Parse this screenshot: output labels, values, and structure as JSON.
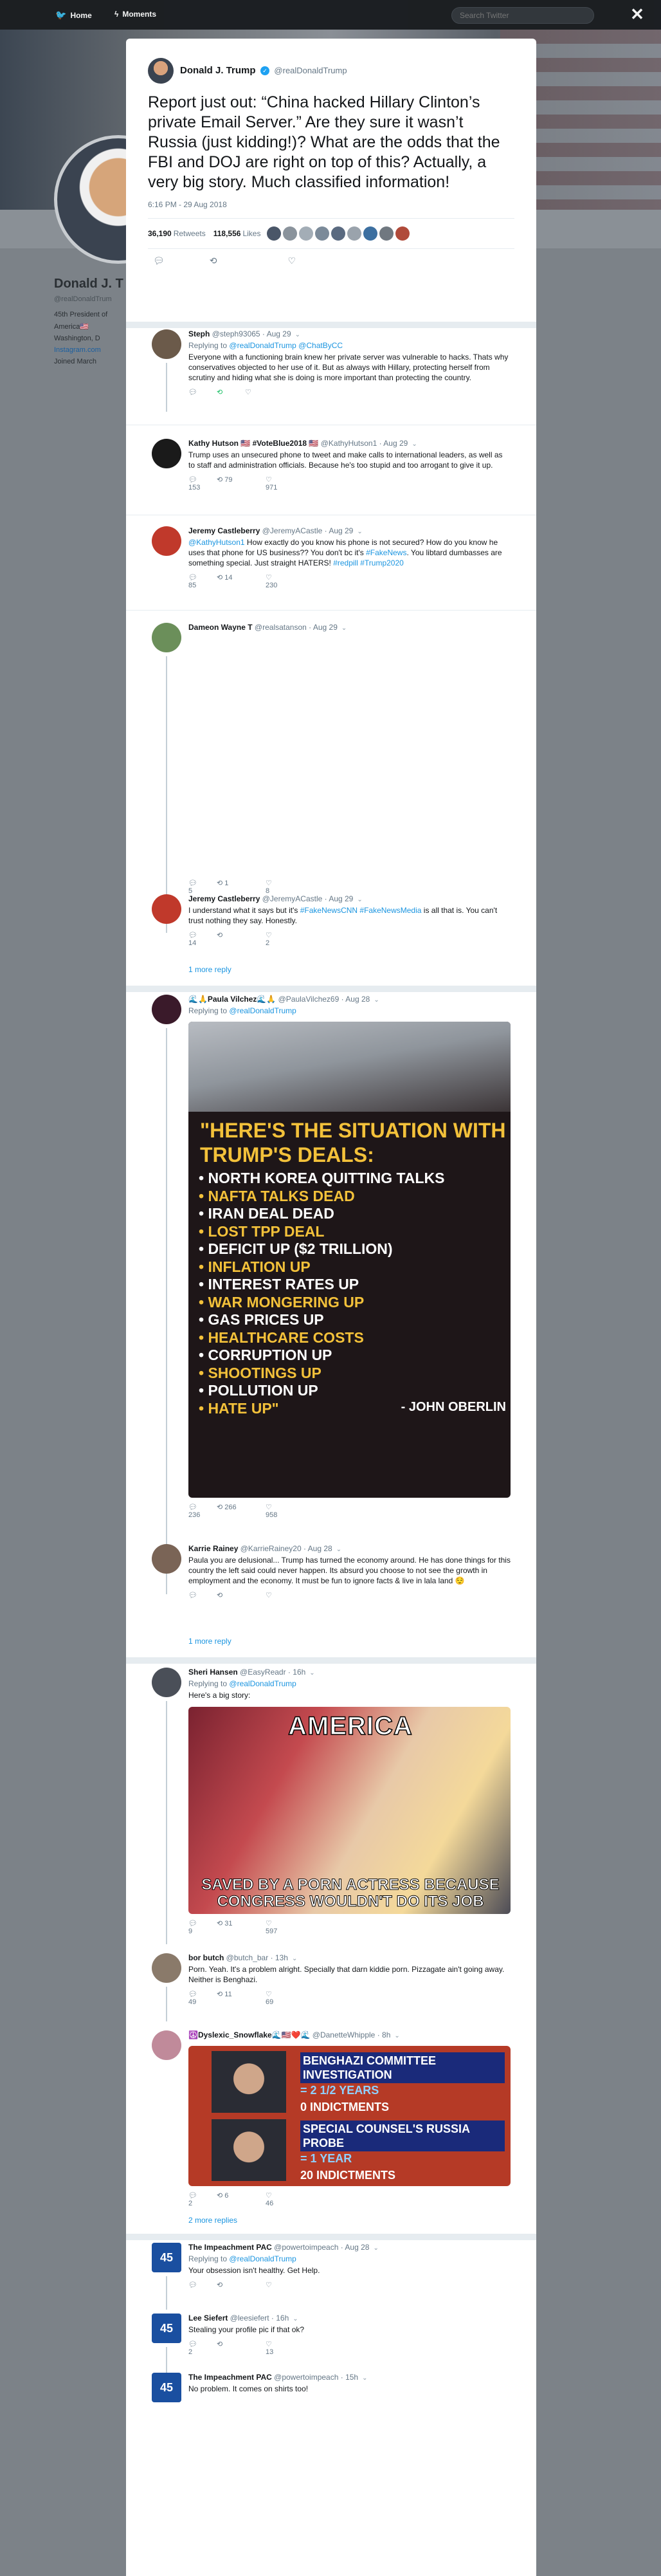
{
  "nav": {
    "home": "Home",
    "moments": "Moments",
    "search_placeholder": "Search Twitter",
    "close": "✕"
  },
  "background_profile": {
    "name": "Donald J. T",
    "handle": "@realDonaldTrum",
    "bio": "45th President of",
    "bio2": "America🇺🇸",
    "location": "Washington, D",
    "link": "Instagram.com",
    "joined": "Joined March"
  },
  "tweet": {
    "name": "Donald J. Trump",
    "handle": "@realDonaldTrump",
    "text": "Report just out: “China hacked Hillary Clinton’s private Email Server.” Are they sure it wasn’t Russia (just kidding!)? What are the odds that the FBI and DOJ are right on top of this? Actually, a very big story. Much classified information!",
    "time": "6:16 PM - 29 Aug 2018",
    "retweets": "36,190",
    "retweets_label": "Retweets",
    "likes": "118,556",
    "likes_label": "Likes"
  },
  "replies": [
    {
      "name": "Steph",
      "handle": "@steph93065",
      "date": "Aug 29",
      "replying": "Replying to",
      "replying_to": "@realDonaldTrump @ChatByCC",
      "text": "Everyone with a functioning brain knew her private server was vulnerable to hacks. Thats why conservatives objected to her use of it. But as always with Hillary, protecting herself from scrutiny and hiding what she is doing is more important than protecting the country.",
      "replies_count": "",
      "retweets_count": "",
      "likes_count": ""
    },
    {
      "name": "Kathy Hutson 🇺🇸 #VoteBlue2018 🇺🇸",
      "handle": "@KathyHutson1",
      "date": "Aug 29",
      "text": "Trump uses an unsecured phone to tweet and make calls to international leaders, as well as to staff and administration officials.  Because he's too stupid and too arrogant to give it up.",
      "replies_count": "153",
      "retweets_count": "79",
      "likes_count": "971"
    },
    {
      "name": "Jeremy Castleberry",
      "handle": "@JeremyACastle",
      "date": "Aug 29",
      "text_link": "@KathyHutson1",
      "text": " How exactly do you know his phone is not secured? How do you know he uses that phone for US business?? You don't bc it's ",
      "text_link2": "#FakeNews",
      "text2": ". You libtard dumbasses are something special. Just straight HATERS! ",
      "text_link3": "#redpill #Trump2020",
      "replies_count": "85",
      "retweets_count": "14",
      "likes_count": "230"
    },
    {
      "name": "Dameon Wayne T",
      "handle": "@realsatanson",
      "date": "Aug 29",
      "replies_count": "5",
      "retweets_count": "1",
      "likes_count": "8"
    },
    {
      "name": "Jeremy Castleberry",
      "handle": "@JeremyACastle",
      "date": "Aug 29",
      "text": "I understand what it says but it's ",
      "text_link": "#FakeNewsCNN #FakeNewsMedia",
      "text2": " is all that is. You can't trust nothing they say. Honestly.",
      "replies_count": "14",
      "retweets_count": "",
      "likes_count": "2",
      "more": "1 more reply"
    },
    {
      "name": "🌊🙏Paula Vilchez🌊🙏",
      "handle": "@PaulaVilchez69",
      "date": "Aug 28",
      "replying": "Replying to",
      "replying_to": "@realDonaldTrump",
      "image_heading": "\"HERE'S THE SITUATION WITH TRUMP'S DEALS:",
      "image_items": [
        {
          "t": "NORTH KOREA QUITTING TALKS",
          "c": "w"
        },
        {
          "t": "NAFTA TALKS DEAD",
          "c": "y"
        },
        {
          "t": "IRAN DEAL DEAD",
          "c": "w"
        },
        {
          "t": "LOST TPP DEAL",
          "c": "y"
        },
        {
          "t": "DEFICIT UP ($2 TRILLION)",
          "c": "w"
        },
        {
          "t": "INFLATION UP",
          "c": "y"
        },
        {
          "t": "INTEREST RATES UP",
          "c": "w"
        },
        {
          "t": "WAR MONGERING UP",
          "c": "y"
        },
        {
          "t": "GAS PRICES UP",
          "c": "w"
        },
        {
          "t": "HEALTHCARE COSTS",
          "c": "y"
        },
        {
          "t": "CORRUPTION UP",
          "c": "w"
        },
        {
          "t": "SHOOTINGS UP",
          "c": "y"
        },
        {
          "t": "POLLUTION UP",
          "c": "w"
        },
        {
          "t": "HATE UP\"",
          "c": "y"
        }
      ],
      "image_credit": "- JOHN OBERLIN",
      "replies_count": "236",
      "retweets_count": "266",
      "likes_count": "958"
    },
    {
      "name": "Karrie Rainey",
      "handle": "@KarrieRainey20",
      "date": "Aug 28",
      "text": "Paula you are delusional... Trump has turned the economy around. He has done things for this country the left said could never happen. Its absurd you choose to not see the growth in employment and the economy. It must be fun to ignore facts & live in lala land 😌",
      "replies_count": "",
      "retweets_count": "",
      "likes_count": "",
      "more": "1 more reply"
    },
    {
      "name": "Sheri Hansen",
      "handle": "@EasyReadr",
      "date": "16h",
      "replying": "Replying to",
      "replying_to": "@realDonaldTrump",
      "text": "Here's a big story:",
      "image_top": "AMERICA",
      "image_bottom": "SAVED BY A PORN ACTRESS BECAUSE CONGRESS WOULDN'T DO ITS JOB",
      "replies_count": "9",
      "retweets_count": "31",
      "likes_count": "597"
    },
    {
      "name": "bor butch",
      "handle": "@butch_bar",
      "date": "13h",
      "text": "Porn.  Yeah.  It's a problem alright.  Specially that darn kiddie porn.  Pizzagate ain't going away.  Neither is Benghazi.",
      "replies_count": "49",
      "retweets_count": "11",
      "likes_count": "69"
    },
    {
      "name": "☮️Dyslexic_Snowflake🌊🇺🇸❤️🌊",
      "handle": "@DanetteWhipple",
      "date": "8h",
      "img_block1_title": "BENGHAZI COMMITTEE INVESTIGATION",
      "img_block1_hl": "= 2 1/2 YEARS",
      "img_block1_sub": "0 INDICTMENTS",
      "img_block2_title": "SPECIAL COUNSEL'S RUSSIA PROBE",
      "img_block2_hl": "= 1 YEAR",
      "img_block2_sub": "20 INDICTMENTS",
      "replies_count": "2",
      "retweets_count": "6",
      "likes_count": "46",
      "more": "2 more replies"
    },
    {
      "name": "The Impeachment PAC",
      "handle": "@powertoimpeach",
      "date": "Aug 28",
      "replying": "Replying to",
      "replying_to": "@realDonaldTrump",
      "text": "Your obsession isn't healthy. Get Help.",
      "replies_count": "",
      "retweets_count": "",
      "likes_count": ""
    },
    {
      "name": "Lee Siefert",
      "handle": "@leesiefert",
      "date": "16h",
      "text": "Stealing your profile pic if that ok?",
      "replies_count": "2",
      "retweets_count": "",
      "likes_count": "13"
    },
    {
      "name": "The Impeachment PAC",
      "handle": "@powertoimpeach",
      "date": "15h",
      "text": "No problem. It comes on shirts too!"
    }
  ],
  "badge_45": "45"
}
